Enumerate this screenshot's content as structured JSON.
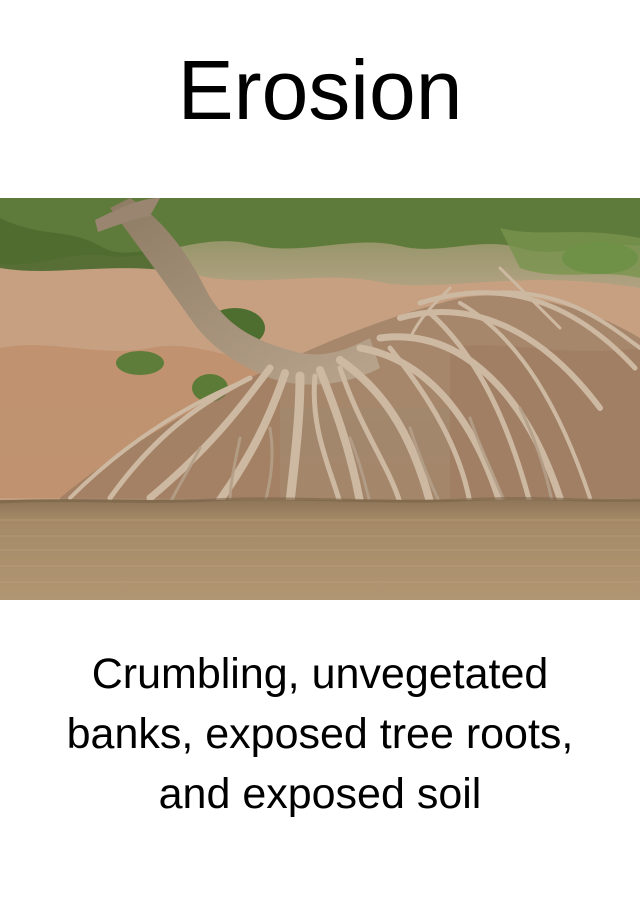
{
  "title": "Erosion",
  "caption": {
    "lines": [
      "Crumbling, unvegetated",
      "banks, exposed tree roots,",
      "and exposed soil"
    ]
  },
  "photo": {
    "subject": "tree-with-exposed-roots-on-eroded-riverbank",
    "colors": {
      "water": "#a88d69",
      "bank_soil": "#c89b78",
      "roots": "#c9b49d",
      "foliage": "#5f7d3a",
      "background": "#b8ad8c"
    }
  }
}
